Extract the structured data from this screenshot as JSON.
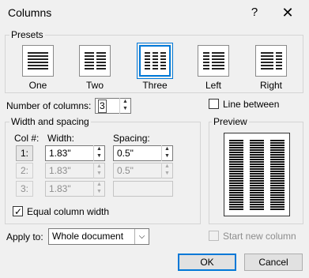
{
  "window": {
    "title": "Columns",
    "help": "?",
    "close": "✕"
  },
  "presets": {
    "label": "Presets",
    "items": [
      {
        "label": "One"
      },
      {
        "label": "Two"
      },
      {
        "label": "Three",
        "selected": true
      },
      {
        "label": "Left"
      },
      {
        "label": "Right"
      }
    ]
  },
  "number_of_columns": {
    "label": "Number of columns:",
    "value": "3"
  },
  "line_between": {
    "label": "Line between",
    "checked": false
  },
  "width_spacing": {
    "label": "Width and spacing",
    "col_header": "Col #:",
    "width_header": "Width:",
    "spacing_header": "Spacing:",
    "rows": [
      {
        "col": "1:",
        "width": "1.83\"",
        "spacing": "0.5\"",
        "enabled": true
      },
      {
        "col": "2:",
        "width": "1.83\"",
        "spacing": "0.5\"",
        "enabled": false
      },
      {
        "col": "3:",
        "width": "1.83\"",
        "spacing": "",
        "enabled": false
      }
    ]
  },
  "equal_width": {
    "label": "Equal column width",
    "checked": true
  },
  "preview": {
    "label": "Preview"
  },
  "apply_to": {
    "label": "Apply to:",
    "value": "Whole document"
  },
  "start_new_column": {
    "label": "Start new column",
    "checked": false,
    "enabled": false
  },
  "buttons": {
    "ok": "OK",
    "cancel": "Cancel"
  },
  "colors": {
    "accent": "#0078d7",
    "background": "#f0f0f0"
  }
}
